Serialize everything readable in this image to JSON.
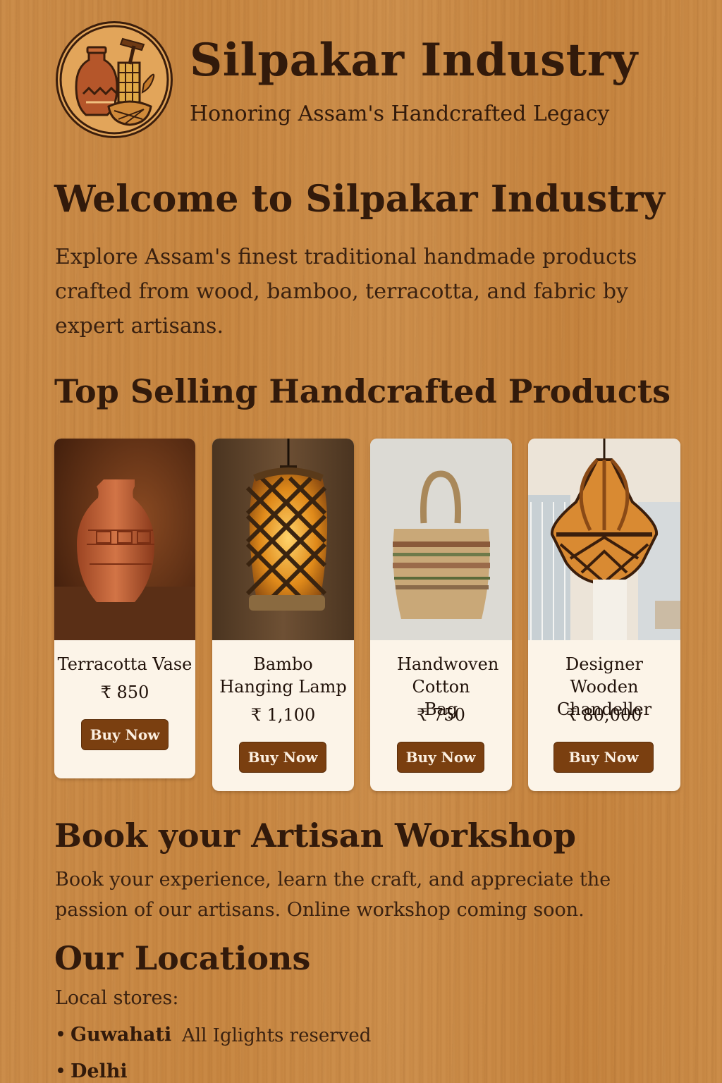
{
  "header": {
    "title": "Silpakar Industry",
    "tagline": "Honoring Assam's Handcrafted Legacy",
    "logo_icon": "crafts-logo-icon"
  },
  "welcome": {
    "heading": "Welcome to Silpakar Industry",
    "text": "Explore Assam's finest traditional handmade products crafted from wood, bamboo, terracotta, and fabric by expert artisans."
  },
  "products": {
    "heading": "Top Selling Handcrafted Products",
    "items": [
      {
        "name": "Terracotta Vase",
        "price": "₹ 850",
        "button": "Buy Now"
      },
      {
        "name": "Bambo Hanging Lamp",
        "price": "₹ 1,100",
        "button": "Buy Now"
      },
      {
        "name": "Handwoven Cotton Bag",
        "price": "₹ 750",
        "button": "Buy Now"
      },
      {
        "name": "Designer Wooden Chandeller",
        "price": "₹ 80,000",
        "button": "Buy Now"
      }
    ]
  },
  "workshop": {
    "heading": "Book your Artisan Workshop",
    "text": "Book your experience, learn the craft, and appreciate the passion of our artisans. Online workshop coming soon."
  },
  "locations": {
    "heading": "Our Locations",
    "label": "Local stores:",
    "stores": [
      "Guwahati",
      "Delhi"
    ],
    "bullet": "•",
    "rights": "All  Iglights reserved"
  },
  "colors": {
    "background": "#c8843f",
    "heading_text": "#321a0b",
    "card_bg": "#fcf4e8",
    "button_bg": "#7a3f10",
    "button_text": "#fcefe0"
  }
}
